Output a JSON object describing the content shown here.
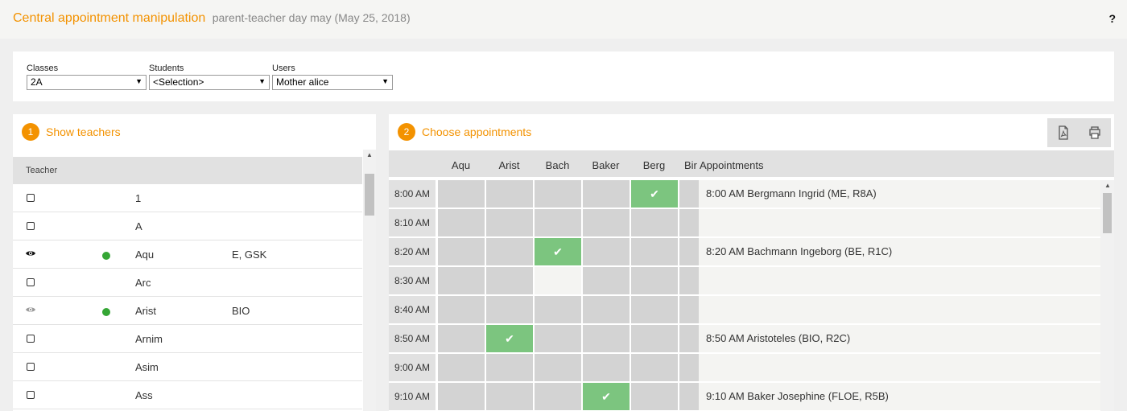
{
  "header": {
    "title": "Central appointment manipulation",
    "subtitle": "parent-teacher day may (May 25, 2018)",
    "help": "?"
  },
  "filters": {
    "classes_label": "Classes",
    "classes_value": "2A",
    "students_label": "Students",
    "students_value": "<Selection>",
    "users_label": "Users",
    "users_value": "Mother alice"
  },
  "teachers_panel": {
    "step": "1",
    "title": "Show teachers",
    "column_header": "Teacher",
    "rows": [
      {
        "name": "1",
        "subjects": "",
        "state": "checkbox",
        "online": false
      },
      {
        "name": "A",
        "subjects": "",
        "state": "checkbox",
        "online": false
      },
      {
        "name": "Aqu",
        "subjects": "E, GSK",
        "state": "eye",
        "online": true
      },
      {
        "name": "Arc",
        "subjects": "",
        "state": "checkbox",
        "online": false
      },
      {
        "name": "Arist",
        "subjects": "BIO",
        "state": "eye-dim",
        "online": true
      },
      {
        "name": "Arnim",
        "subjects": "",
        "state": "checkbox",
        "online": false
      },
      {
        "name": "Asim",
        "subjects": "",
        "state": "checkbox",
        "online": false
      },
      {
        "name": "Ass",
        "subjects": "",
        "state": "checkbox",
        "online": false
      }
    ]
  },
  "appointments_panel": {
    "step": "2",
    "title": "Choose appointments",
    "pdf_icon": "pdf-icon",
    "print_icon": "print-icon",
    "teacher_columns": [
      "Aqu",
      "Arist",
      "Bach",
      "Baker",
      "Berg",
      "Bir"
    ],
    "appointments_header": "Appointments",
    "slots": [
      {
        "time": "8:00 AM",
        "booked": "Berg",
        "free": [],
        "appointment": "8:00 AM Bergmann Ingrid (ME, R8A)"
      },
      {
        "time": "8:10 AM",
        "booked": "",
        "free": [],
        "appointment": ""
      },
      {
        "time": "8:20 AM",
        "booked": "Bach",
        "free": [],
        "appointment": "8:20 AM Bachmann Ingeborg (BE, R1C)"
      },
      {
        "time": "8:30 AM",
        "booked": "",
        "free": [
          "Bach"
        ],
        "appointment": ""
      },
      {
        "time": "8:40 AM",
        "booked": "",
        "free": [],
        "appointment": ""
      },
      {
        "time": "8:50 AM",
        "booked": "Arist",
        "free": [],
        "appointment": "8:50 AM Aristoteles (BIO, R2C)"
      },
      {
        "time": "9:00 AM",
        "booked": "",
        "free": [],
        "appointment": ""
      },
      {
        "time": "9:10 AM",
        "booked": "Baker",
        "free": [],
        "appointment": "9:10 AM Baker Josephine (FLOE, R5B)"
      }
    ]
  },
  "colors": {
    "accent": "#f39200",
    "booked": "#7cc57f",
    "online": "#35a635"
  }
}
